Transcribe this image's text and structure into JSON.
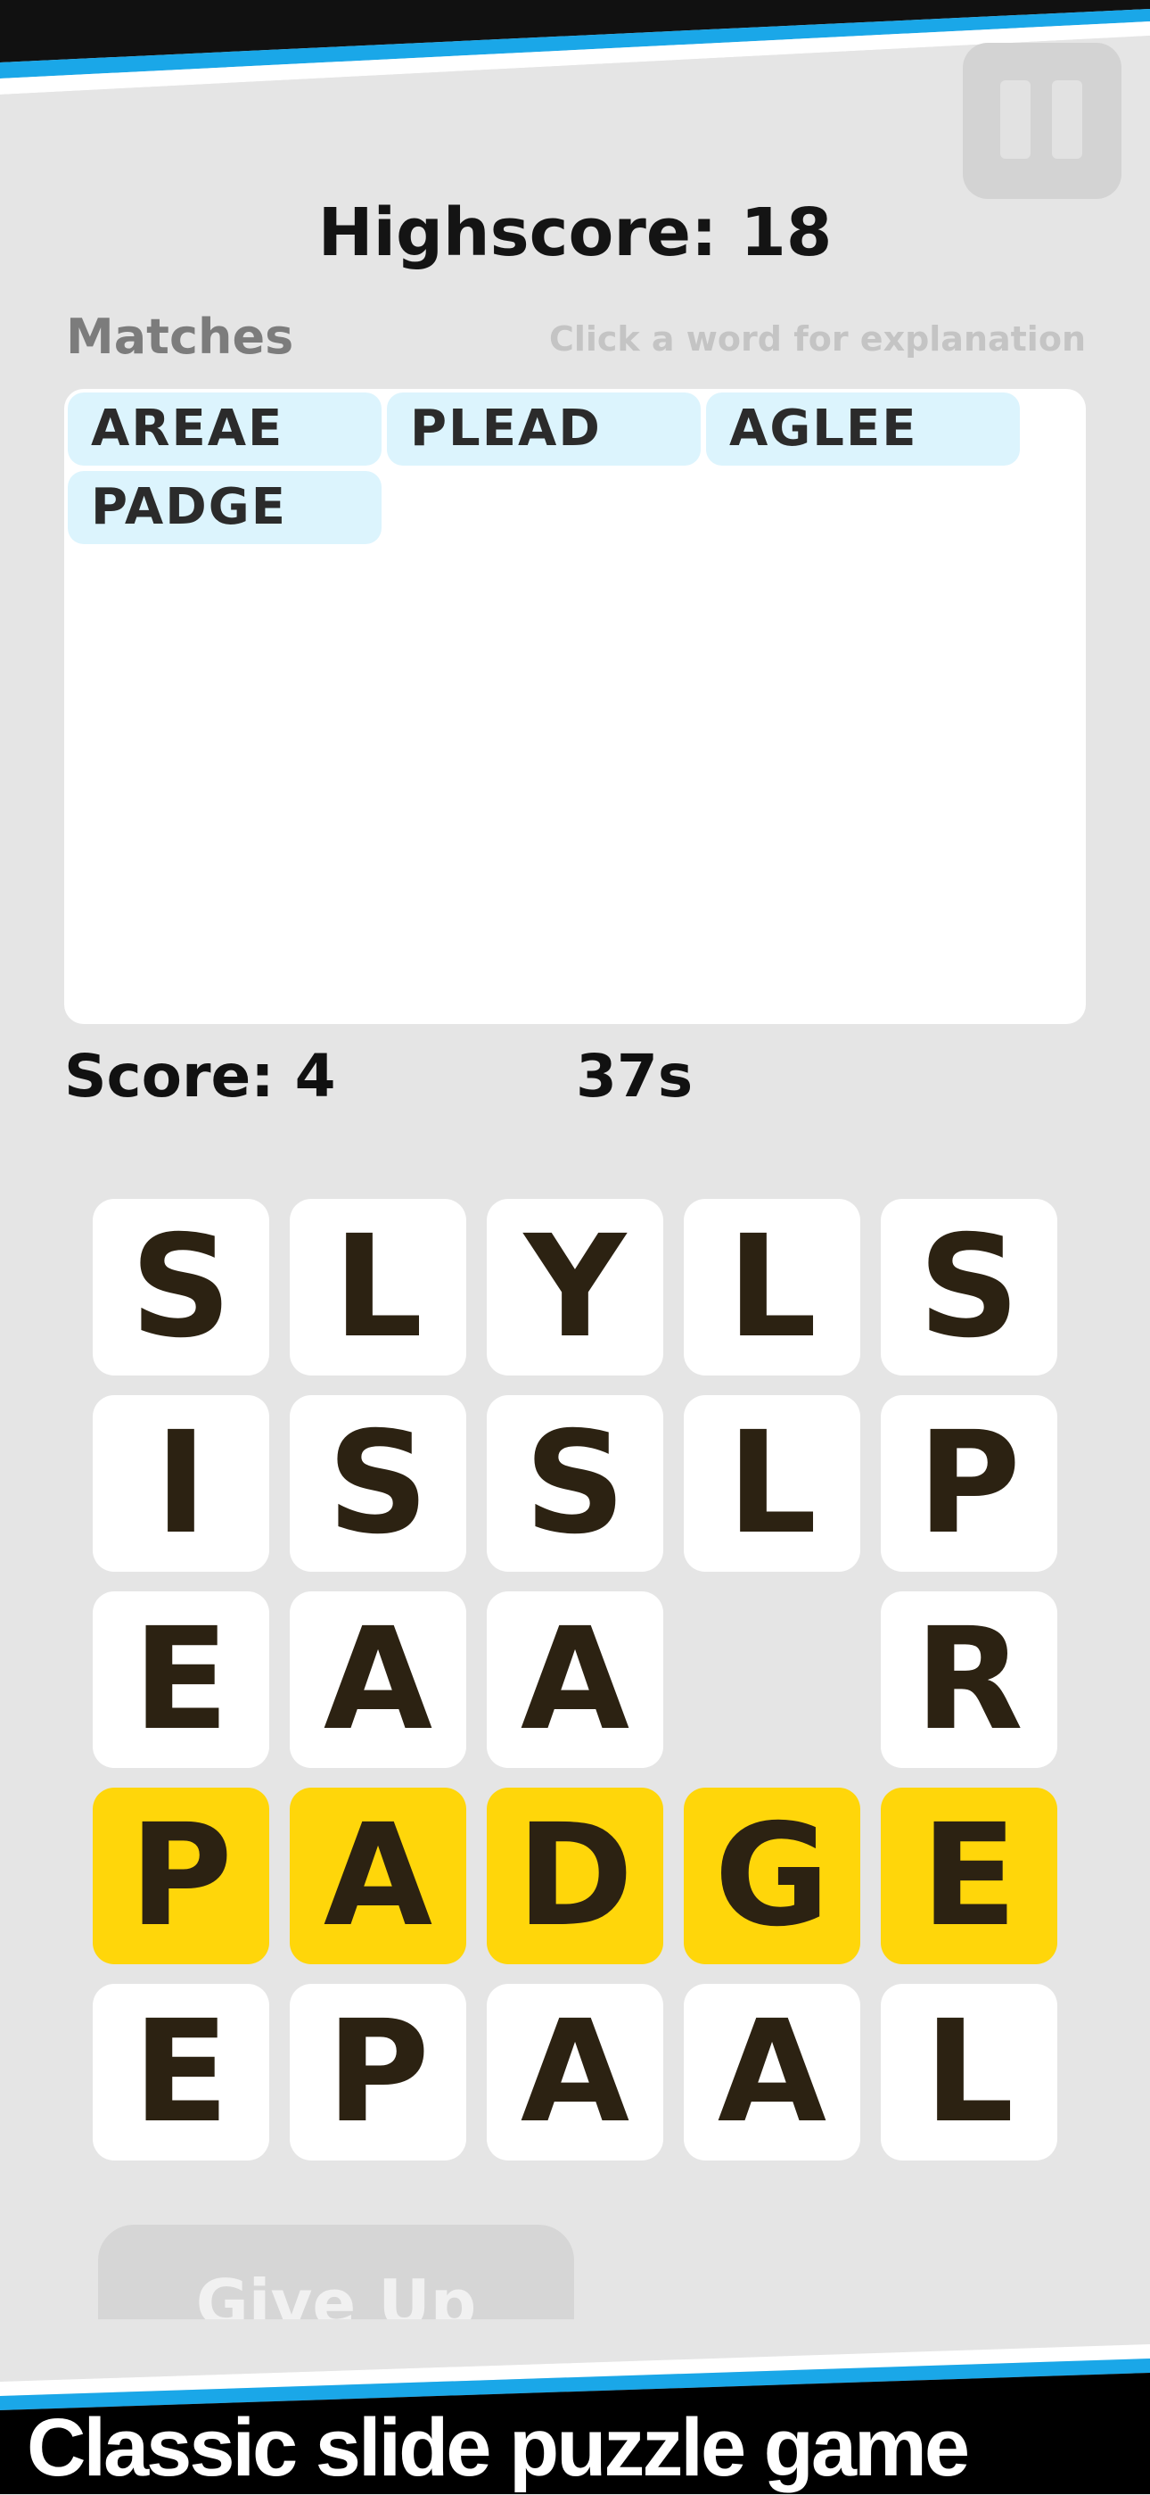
{
  "header": {
    "highscore_text": "Highscore: 18",
    "pause_icon": "pause-icon"
  },
  "matches": {
    "title": "Matches",
    "hint": "Click a word for explanation",
    "words": [
      "AREAE",
      "PLEAD",
      "AGLEE",
      "PADGE"
    ]
  },
  "status": {
    "score_text": "Score: 4",
    "time_text": "37s"
  },
  "grid": {
    "rows": [
      [
        "S",
        "L",
        "Y",
        "L",
        "S"
      ],
      [
        "I",
        "S",
        "S",
        "L",
        "P"
      ],
      [
        "E",
        "A",
        "A",
        "",
        "R"
      ],
      [
        "P",
        "A",
        "D",
        "G",
        "E"
      ],
      [
        "E",
        "P",
        "A",
        "A",
        "L"
      ]
    ],
    "highlighted_row": 3,
    "highlight_color": "#ffd60a",
    "letter_color": "#2c2212"
  },
  "actions": {
    "give_up_label": "Give Up"
  },
  "promo": {
    "caption": "Classic slide puzzle game",
    "accent_color": "#1aa7e8"
  }
}
